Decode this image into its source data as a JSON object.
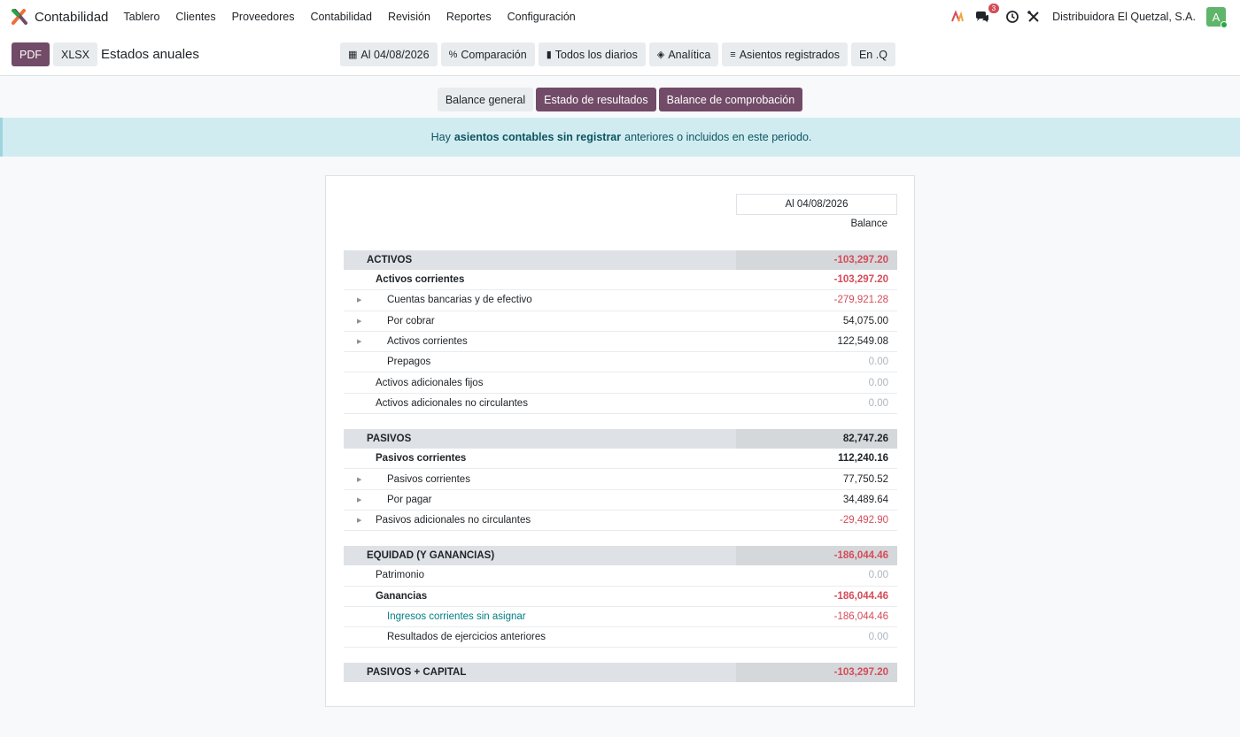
{
  "app": {
    "name": "Contabilidad",
    "brand_colors": [
      "#f26d36",
      "#714b67",
      "#28a745"
    ]
  },
  "nav": {
    "menu": [
      "Tablero",
      "Clientes",
      "Proveedores",
      "Contabilidad",
      "Revisión",
      "Reportes",
      "Configuración"
    ],
    "messages_count": "3",
    "company": "Distribuidora El Quetzal, S.A.",
    "user_initial": "A",
    "icons": [
      "ai-icon",
      "chat-icon",
      "clock-icon",
      "tools-icon"
    ]
  },
  "control": {
    "pdf_label": "PDF",
    "xlsx_label": "XLSX",
    "title": "Estados anuales",
    "filters": [
      {
        "icon": "calendar-icon",
        "label": "Al 04/08/2026"
      },
      {
        "icon": "percent-icon",
        "label": "Comparación"
      },
      {
        "icon": "book-icon",
        "label": "Todos los diarios"
      },
      {
        "icon": "layers-icon",
        "label": "Analítica"
      },
      {
        "icon": "sliders-icon",
        "label": "Asientos registrados"
      },
      {
        "icon": "",
        "label": "En .Q"
      }
    ]
  },
  "report_switch": {
    "balance_general": "Balance general",
    "estado_resultados": "Estado de resultados",
    "balance_comprobacion": "Balance de comprobación"
  },
  "alert": {
    "prefix": "Hay",
    "link": "asientos contables sin registrar",
    "suffix": "anteriores o incluidos en este periodo."
  },
  "report": {
    "column_date": "Al 04/08/2026",
    "column_label": "Balance",
    "rows": [
      {
        "type": "section",
        "label": "ACTIVOS",
        "amount": "-103,297.20",
        "neg": true
      },
      {
        "type": "bold",
        "level": 1,
        "label": "Activos corrientes",
        "amount": "-103,297.20",
        "neg": true
      },
      {
        "type": "line",
        "level": 2,
        "caret": true,
        "label": "Cuentas bancarias y de efectivo",
        "amount": "-279,921.28",
        "neg": true
      },
      {
        "type": "line",
        "level": 2,
        "caret": true,
        "label": "Por cobrar",
        "amount": "54,075.00"
      },
      {
        "type": "line",
        "level": 2,
        "caret": true,
        "label": "Activos corrientes",
        "amount": "122,549.08"
      },
      {
        "type": "line",
        "level": 2,
        "label": "Prepagos",
        "amount": "0.00",
        "zero": true
      },
      {
        "type": "line",
        "level": 1,
        "label": "Activos adicionales fijos",
        "amount": "0.00",
        "zero": true
      },
      {
        "type": "line",
        "level": 1,
        "label": "Activos adicionales no circulantes",
        "amount": "0.00",
        "zero": true
      },
      {
        "type": "gap"
      },
      {
        "type": "section",
        "label": "PASIVOS",
        "amount": "82,747.26"
      },
      {
        "type": "bold",
        "level": 1,
        "label": "Pasivos corrientes",
        "amount": "112,240.16"
      },
      {
        "type": "line",
        "level": 2,
        "caret": true,
        "label": "Pasivos corrientes",
        "amount": "77,750.52"
      },
      {
        "type": "line",
        "level": 2,
        "caret": true,
        "label": "Por pagar",
        "amount": "34,489.64"
      },
      {
        "type": "line",
        "level": 1,
        "caret": true,
        "label": "Pasivos adicionales no circulantes",
        "amount": "-29,492.90",
        "neg": true
      },
      {
        "type": "gap"
      },
      {
        "type": "section",
        "label": "EQUIDAD (Y GANANCIAS)",
        "amount": "-186,044.46",
        "neg": true
      },
      {
        "type": "line",
        "level": 1,
        "label": "Patrimonio",
        "amount": "0.00",
        "zero": true
      },
      {
        "type": "bold",
        "level": 1,
        "label": "Ganancias",
        "amount": "-186,044.46",
        "neg": true
      },
      {
        "type": "line",
        "level": 2,
        "label": "Ingresos corrientes sin asignar",
        "amount": "-186,044.46",
        "neg": true,
        "link": true
      },
      {
        "type": "line",
        "level": 2,
        "label": "Resultados de ejercicios anteriores",
        "amount": "0.00",
        "zero": true
      },
      {
        "type": "gap"
      },
      {
        "type": "section",
        "label": "PASIVOS + CAPITAL",
        "amount": "-103,297.20",
        "neg": true
      }
    ]
  }
}
